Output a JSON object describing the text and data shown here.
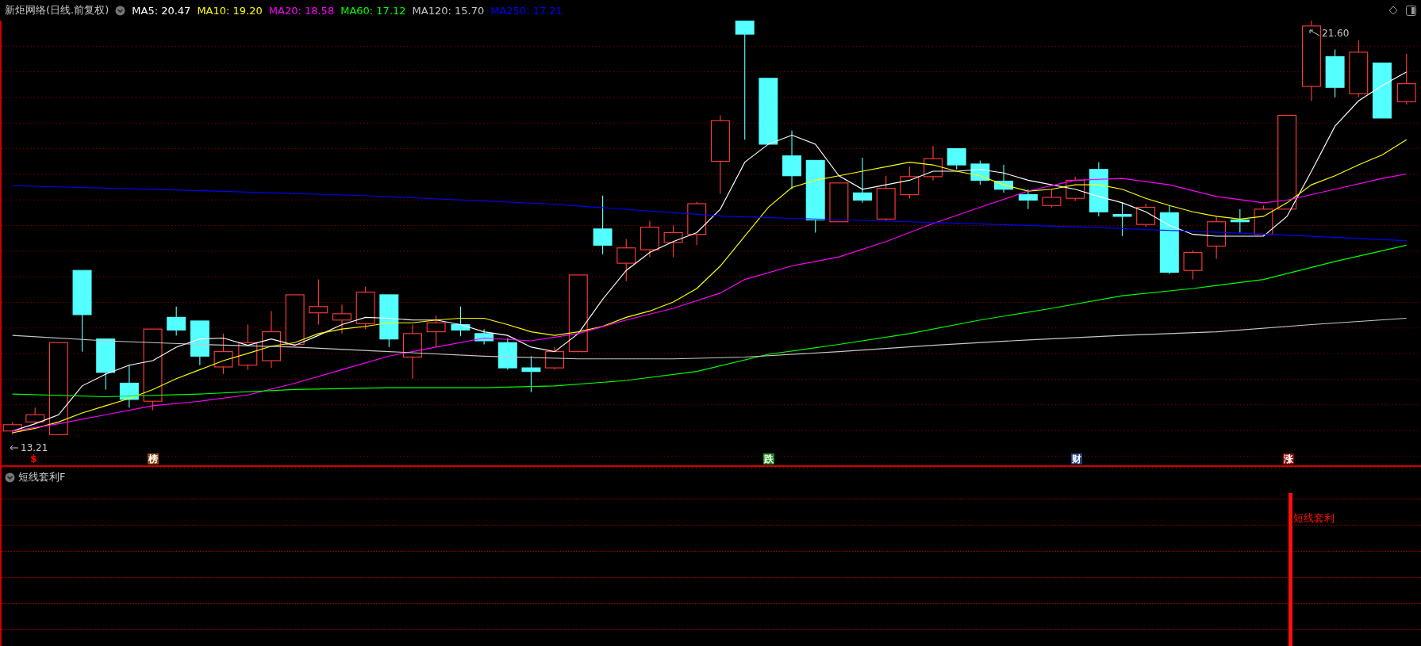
{
  "header": {
    "title": "新炬网络(日线.前复权)",
    "indicators": [
      {
        "label": "MA5: 20.47",
        "color": "#ffffff"
      },
      {
        "label": "MA10: 19.20",
        "color": "#ffff00"
      },
      {
        "label": "MA20: 18.58",
        "color": "#ff00ff"
      },
      {
        "label": "MA60: 17.12",
        "color": "#00ff00"
      },
      {
        "label": "MA120: 15.70",
        "color": "#c8c8c8"
      },
      {
        "label": "MA250: 17.21",
        "color": "#0000ff"
      }
    ]
  },
  "chart": {
    "high_label": "21.60",
    "low_label": "13.21",
    "markers": [
      {
        "kind": "sign",
        "label": "$",
        "color": "#ff0000"
      },
      {
        "kind": "tag",
        "label": "榜",
        "color": "#8b4513"
      },
      {
        "kind": "tag",
        "label": "跌",
        "color": "#1a8a1a"
      },
      {
        "kind": "tag",
        "label": "财",
        "color": "#1f3f7a"
      },
      {
        "kind": "tag",
        "label": "涨",
        "color": "#8b0000"
      }
    ]
  },
  "sub_panel": {
    "title": "短线套利F",
    "signal_label": "短线套利"
  }
}
